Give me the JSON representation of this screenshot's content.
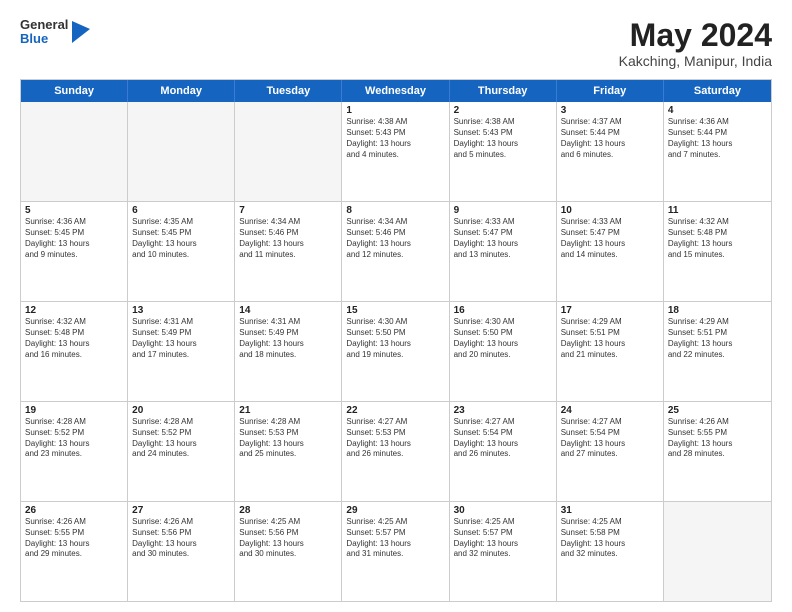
{
  "logo": {
    "line1": "General",
    "line2": "Blue"
  },
  "title": "May 2024",
  "location": "Kakching, Manipur, India",
  "weekdays": [
    "Sunday",
    "Monday",
    "Tuesday",
    "Wednesday",
    "Thursday",
    "Friday",
    "Saturday"
  ],
  "rows": [
    [
      {
        "day": "",
        "info": "",
        "empty": true
      },
      {
        "day": "",
        "info": "",
        "empty": true
      },
      {
        "day": "",
        "info": "",
        "empty": true
      },
      {
        "day": "1",
        "info": "Sunrise: 4:38 AM\nSunset: 5:43 PM\nDaylight: 13 hours\nand 4 minutes."
      },
      {
        "day": "2",
        "info": "Sunrise: 4:38 AM\nSunset: 5:43 PM\nDaylight: 13 hours\nand 5 minutes."
      },
      {
        "day": "3",
        "info": "Sunrise: 4:37 AM\nSunset: 5:44 PM\nDaylight: 13 hours\nand 6 minutes."
      },
      {
        "day": "4",
        "info": "Sunrise: 4:36 AM\nSunset: 5:44 PM\nDaylight: 13 hours\nand 7 minutes."
      }
    ],
    [
      {
        "day": "5",
        "info": "Sunrise: 4:36 AM\nSunset: 5:45 PM\nDaylight: 13 hours\nand 9 minutes."
      },
      {
        "day": "6",
        "info": "Sunrise: 4:35 AM\nSunset: 5:45 PM\nDaylight: 13 hours\nand 10 minutes."
      },
      {
        "day": "7",
        "info": "Sunrise: 4:34 AM\nSunset: 5:46 PM\nDaylight: 13 hours\nand 11 minutes."
      },
      {
        "day": "8",
        "info": "Sunrise: 4:34 AM\nSunset: 5:46 PM\nDaylight: 13 hours\nand 12 minutes."
      },
      {
        "day": "9",
        "info": "Sunrise: 4:33 AM\nSunset: 5:47 PM\nDaylight: 13 hours\nand 13 minutes."
      },
      {
        "day": "10",
        "info": "Sunrise: 4:33 AM\nSunset: 5:47 PM\nDaylight: 13 hours\nand 14 minutes."
      },
      {
        "day": "11",
        "info": "Sunrise: 4:32 AM\nSunset: 5:48 PM\nDaylight: 13 hours\nand 15 minutes."
      }
    ],
    [
      {
        "day": "12",
        "info": "Sunrise: 4:32 AM\nSunset: 5:48 PM\nDaylight: 13 hours\nand 16 minutes."
      },
      {
        "day": "13",
        "info": "Sunrise: 4:31 AM\nSunset: 5:49 PM\nDaylight: 13 hours\nand 17 minutes."
      },
      {
        "day": "14",
        "info": "Sunrise: 4:31 AM\nSunset: 5:49 PM\nDaylight: 13 hours\nand 18 minutes."
      },
      {
        "day": "15",
        "info": "Sunrise: 4:30 AM\nSunset: 5:50 PM\nDaylight: 13 hours\nand 19 minutes."
      },
      {
        "day": "16",
        "info": "Sunrise: 4:30 AM\nSunset: 5:50 PM\nDaylight: 13 hours\nand 20 minutes."
      },
      {
        "day": "17",
        "info": "Sunrise: 4:29 AM\nSunset: 5:51 PM\nDaylight: 13 hours\nand 21 minutes."
      },
      {
        "day": "18",
        "info": "Sunrise: 4:29 AM\nSunset: 5:51 PM\nDaylight: 13 hours\nand 22 minutes."
      }
    ],
    [
      {
        "day": "19",
        "info": "Sunrise: 4:28 AM\nSunset: 5:52 PM\nDaylight: 13 hours\nand 23 minutes."
      },
      {
        "day": "20",
        "info": "Sunrise: 4:28 AM\nSunset: 5:52 PM\nDaylight: 13 hours\nand 24 minutes."
      },
      {
        "day": "21",
        "info": "Sunrise: 4:28 AM\nSunset: 5:53 PM\nDaylight: 13 hours\nand 25 minutes."
      },
      {
        "day": "22",
        "info": "Sunrise: 4:27 AM\nSunset: 5:53 PM\nDaylight: 13 hours\nand 26 minutes."
      },
      {
        "day": "23",
        "info": "Sunrise: 4:27 AM\nSunset: 5:54 PM\nDaylight: 13 hours\nand 26 minutes."
      },
      {
        "day": "24",
        "info": "Sunrise: 4:27 AM\nSunset: 5:54 PM\nDaylight: 13 hours\nand 27 minutes."
      },
      {
        "day": "25",
        "info": "Sunrise: 4:26 AM\nSunset: 5:55 PM\nDaylight: 13 hours\nand 28 minutes."
      }
    ],
    [
      {
        "day": "26",
        "info": "Sunrise: 4:26 AM\nSunset: 5:55 PM\nDaylight: 13 hours\nand 29 minutes."
      },
      {
        "day": "27",
        "info": "Sunrise: 4:26 AM\nSunset: 5:56 PM\nDaylight: 13 hours\nand 30 minutes."
      },
      {
        "day": "28",
        "info": "Sunrise: 4:25 AM\nSunset: 5:56 PM\nDaylight: 13 hours\nand 30 minutes."
      },
      {
        "day": "29",
        "info": "Sunrise: 4:25 AM\nSunset: 5:57 PM\nDaylight: 13 hours\nand 31 minutes."
      },
      {
        "day": "30",
        "info": "Sunrise: 4:25 AM\nSunset: 5:57 PM\nDaylight: 13 hours\nand 32 minutes."
      },
      {
        "day": "31",
        "info": "Sunrise: 4:25 AM\nSunset: 5:58 PM\nDaylight: 13 hours\nand 32 minutes."
      },
      {
        "day": "",
        "info": "",
        "empty": true
      }
    ]
  ]
}
